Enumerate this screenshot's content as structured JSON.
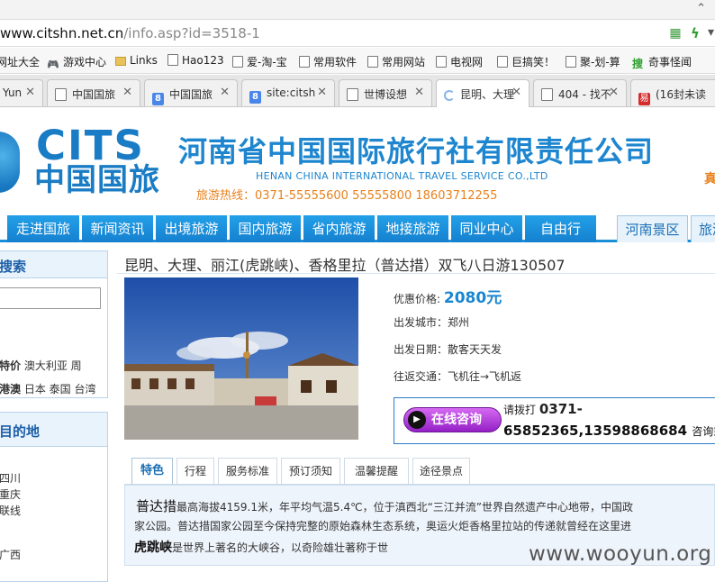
{
  "browser": {
    "url_host": "www.citshn.net.cn",
    "url_path": "/info.asp?id=3518-1",
    "bookmarks": [
      {
        "label": "网址大全"
      },
      {
        "label": "游戏中心"
      },
      {
        "label": "Links"
      },
      {
        "label": "Hao123"
      },
      {
        "label": "爱-淘-宝"
      },
      {
        "label": "常用软件"
      },
      {
        "label": "常用网站"
      },
      {
        "label": "电视网"
      },
      {
        "label": "巨搞笑！"
      },
      {
        "label": "聚-划-算"
      },
      {
        "label": "奇事怪闻"
      }
    ],
    "tabs": [
      {
        "label": "Yun"
      },
      {
        "label": "中国国旅"
      },
      {
        "label": "中国国旅"
      },
      {
        "label": "site:citsh"
      },
      {
        "label": "世博设想"
      },
      {
        "label": "昆明、大理"
      },
      {
        "label": "404 - 找不"
      },
      {
        "label": "(16封未读"
      }
    ]
  },
  "site": {
    "logo_en": "CITS",
    "logo_cn": "中国国旅",
    "company_name": "河南省中国国际旅行社有限责任公司",
    "company_en": "HENAN CHINA INTERNATIONAL TRAVEL SERVICE CO.,LTD",
    "hotline": "旅游热线：0371-55555600  55555800  18603712255",
    "head_right": "真"
  },
  "nav": [
    {
      "label": "走进国旅"
    },
    {
      "label": "新闻资讯"
    },
    {
      "label": "出境旅游"
    },
    {
      "label": "国内旅游"
    },
    {
      "label": "省内旅游"
    },
    {
      "label": "地接旅游"
    },
    {
      "label": "同业中心"
    },
    {
      "label": "自由行"
    },
    {
      "label": "河南景区"
    },
    {
      "label": "旅游"
    }
  ],
  "sidebar": {
    "search_title": "搜索",
    "hot_label": "特价",
    "hot_links": "澳大利亚 周",
    "hot2_label": "港澳",
    "hot2_links": "日本 泰国 台湾",
    "dest_title": "目的地",
    "dest_items": [
      "四川",
      "重庆",
      "联线",
      "广西"
    ]
  },
  "product": {
    "title": "昆明、大理、丽江(虎跳峡)、香格里拉（普达措）双飞八日游130507",
    "price_label": "优惠价格:",
    "price": "2080元",
    "depart_city": "出发城市：郑州",
    "depart_date": "出发日期：散客天天发",
    "transport": "往返交通：飞机往→飞机返",
    "consult_btn": "在线咨询",
    "call_prefix": "请拨打",
    "call_num1": "0371-",
    "call_num2": "65852365,13598868684",
    "call_suffix": "咨询或"
  },
  "content_tabs": [
    {
      "label": "特色"
    },
    {
      "label": "行程"
    },
    {
      "label": "服务标准"
    },
    {
      "label": "预订须知"
    },
    {
      "label": "温馨提醒"
    },
    {
      "label": "途径景点"
    }
  ],
  "description": {
    "line1_bold": "普达措",
    "line1": "最高海拔4159.1米，年平均气温5.4℃，位于滇西北“三江并流”世界自然遗产中心地带，中国政",
    "line2": "家公园。普达措国家公园至今保持完整的原始森林生态系统，奥运火炬香格里拉站的传递就曾经在这里进",
    "line3_bold": "虎跳峡",
    "line3": "是世界上著名的大峡谷，以奇险雄壮著称于世"
  },
  "watermark": "www.wooyun.org"
}
